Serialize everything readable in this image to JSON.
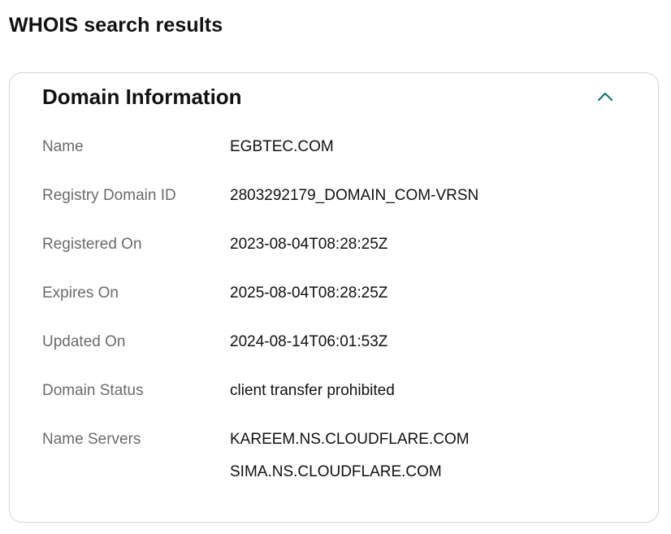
{
  "page": {
    "title": "WHOIS search results"
  },
  "domain_info": {
    "title": "Domain Information",
    "toggle_icon": "chevron-up-icon",
    "accent_color": "#0b7a75",
    "fields": [
      {
        "label": "Name",
        "value": "EGBTEC.COM"
      },
      {
        "label": "Registry Domain ID",
        "value": "2803292179_DOMAIN_COM-VRSN"
      },
      {
        "label": "Registered On",
        "value": "2023-08-04T08:28:25Z"
      },
      {
        "label": "Expires On",
        "value": "2025-08-04T08:28:25Z"
      },
      {
        "label": "Updated On",
        "value": "2024-08-14T06:01:53Z"
      },
      {
        "label": "Domain Status",
        "value": "client transfer prohibited"
      }
    ],
    "name_servers": {
      "label": "Name Servers",
      "values": [
        "KAREEM.NS.CLOUDFLARE.COM",
        "SIMA.NS.CLOUDFLARE.COM"
      ]
    }
  }
}
